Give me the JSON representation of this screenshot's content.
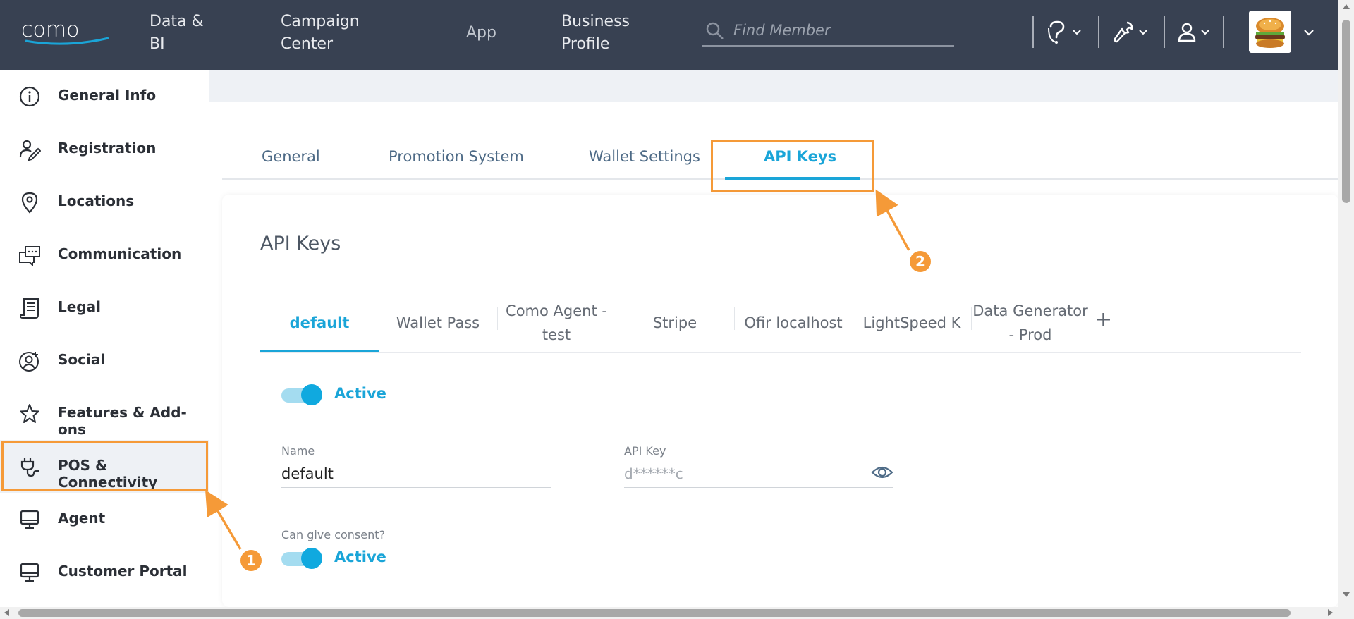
{
  "topbar": {
    "logo_text": "como",
    "nav": [
      {
        "label_line1": "Data &",
        "label_line2": "BI"
      },
      {
        "label_line1": "Campaign",
        "label_line2": "Center"
      },
      {
        "label_line1": "App",
        "label_line2": ""
      },
      {
        "label_line1": "Business",
        "label_line2": "Profile"
      }
    ],
    "search_placeholder": "Find Member",
    "icons": [
      "help-icon",
      "tools-icon",
      "user-icon"
    ],
    "avatar": "burger-logo"
  },
  "sidebar": {
    "items": [
      {
        "label": "General Info",
        "icon": "info-icon"
      },
      {
        "label": "Registration",
        "icon": "registration-icon"
      },
      {
        "label": "Locations",
        "icon": "location-pin-icon"
      },
      {
        "label": "Communication",
        "icon": "communication-icon"
      },
      {
        "label": "Legal",
        "icon": "document-icon"
      },
      {
        "label": "Social",
        "icon": "social-icon"
      },
      {
        "label": "Features & Add-ons",
        "icon": "star-icon"
      },
      {
        "label": "POS & Connectivity",
        "icon": "plug-icon"
      },
      {
        "label": "Agent",
        "icon": "monitor-icon"
      },
      {
        "label": "Customer Portal",
        "icon": "monitor-icon"
      }
    ],
    "active_index": 7
  },
  "main_tabs": [
    {
      "label": "General"
    },
    {
      "label": "Promotion System"
    },
    {
      "label": "Wallet Settings"
    },
    {
      "label": "API Keys"
    }
  ],
  "active_main_tab": "API Keys",
  "card": {
    "title": "API Keys",
    "key_tabs": [
      {
        "line1": "default",
        "line2": ""
      },
      {
        "line1": "Wallet Pass",
        "line2": ""
      },
      {
        "line1": "Como Agent -",
        "line2": "test"
      },
      {
        "line1": "Stripe",
        "line2": ""
      },
      {
        "line1": "Ofir localhost",
        "line2": ""
      },
      {
        "line1": "LightSpeed K",
        "line2": ""
      },
      {
        "line1": "Data Generator",
        "line2": "- Prod"
      }
    ],
    "add_label": "+",
    "active_toggle_label": "Active",
    "name_label": "Name",
    "name_value": "default",
    "api_key_label": "API Key",
    "api_key_value": "d******c",
    "consent_label": "Can give consent?",
    "consent_toggle_label": "Active"
  },
  "annotations": [
    {
      "number": "1"
    },
    {
      "number": "2"
    }
  ],
  "colors": {
    "accent": "#1aa5d8",
    "topbar_bg": "#384152",
    "highlight": "#f59a38"
  }
}
